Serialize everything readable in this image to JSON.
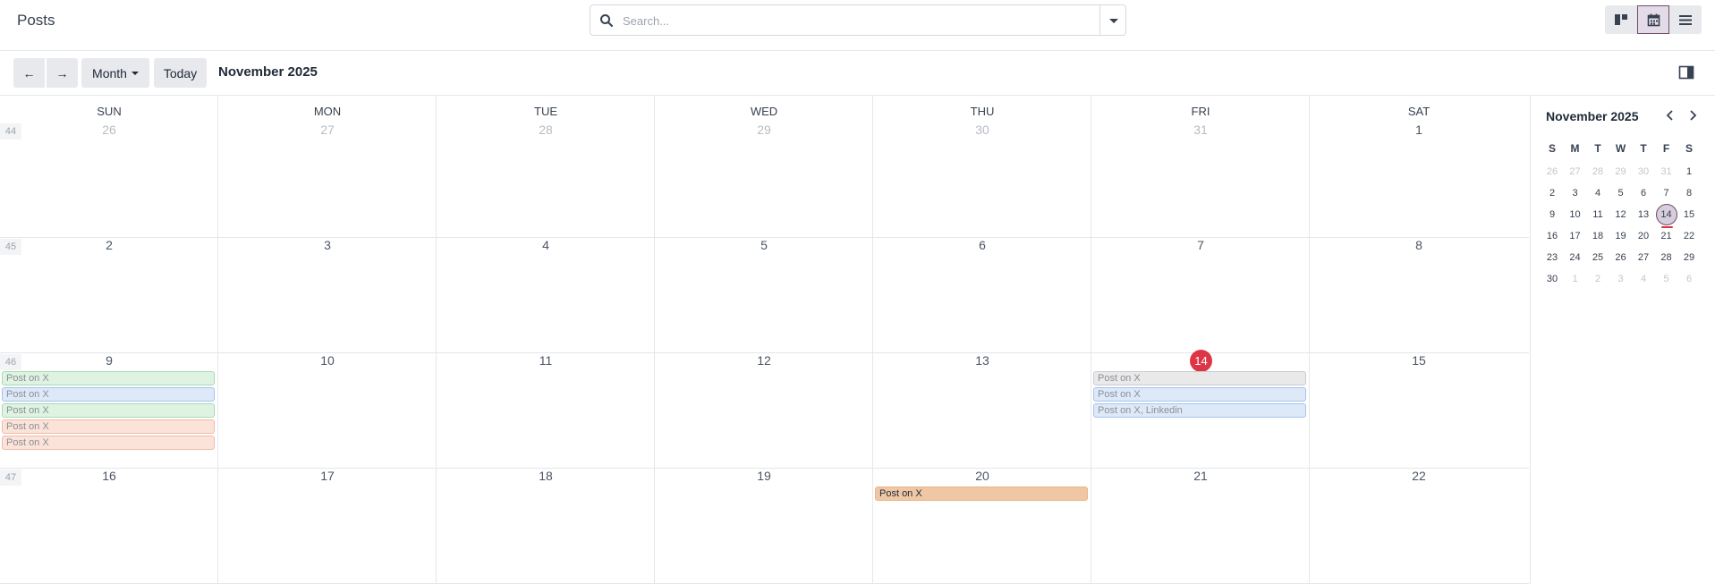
{
  "app": {
    "title": "Posts"
  },
  "search": {
    "placeholder": "Search..."
  },
  "views": [
    "kanban-view",
    "calendar-view",
    "list-view"
  ],
  "controls": {
    "prev_label": "←",
    "next_label": "→",
    "scale_label": "Month",
    "today_label": "Today",
    "period_title": "November 2025"
  },
  "calendar": {
    "day_headers": [
      "SUN",
      "MON",
      "TUE",
      "WED",
      "THU",
      "FRI",
      "SAT"
    ],
    "weeks": [
      {
        "number": "44",
        "days": [
          "26",
          "27",
          "28",
          "29",
          "30",
          "31",
          "1"
        ],
        "muted": [
          true,
          true,
          true,
          true,
          true,
          true,
          false
        ]
      },
      {
        "number": "45",
        "days": [
          "2",
          "3",
          "4",
          "5",
          "6",
          "7",
          "8"
        ],
        "muted": [
          false,
          false,
          false,
          false,
          false,
          false,
          false
        ]
      },
      {
        "number": "46",
        "days": [
          "9",
          "10",
          "11",
          "12",
          "13",
          "14",
          "15"
        ],
        "muted": [
          false,
          false,
          false,
          false,
          false,
          false,
          false
        ]
      },
      {
        "number": "47",
        "days": [
          "16",
          "17",
          "18",
          "19",
          "20",
          "21",
          "22"
        ],
        "muted": [
          false,
          false,
          false,
          false,
          false,
          false,
          false
        ]
      }
    ],
    "today": "14",
    "events": [
      {
        "label": "Post on X",
        "week": 2,
        "day": 0,
        "slot": 0,
        "color": "green"
      },
      {
        "label": "Post on X",
        "week": 2,
        "day": 0,
        "slot": 1,
        "color": "blue"
      },
      {
        "label": "Post on X",
        "week": 2,
        "day": 0,
        "slot": 2,
        "color": "green"
      },
      {
        "label": "Post on X",
        "week": 2,
        "day": 0,
        "slot": 3,
        "color": "salmon"
      },
      {
        "label": "Post on X",
        "week": 2,
        "day": 0,
        "slot": 4,
        "color": "salmon"
      },
      {
        "label": "Post on X",
        "week": 2,
        "day": 5,
        "slot": 0,
        "color": "gray"
      },
      {
        "label": "Post on X",
        "week": 2,
        "day": 5,
        "slot": 1,
        "color": "blue"
      },
      {
        "label": "Post on X, Linkedin",
        "week": 2,
        "day": 5,
        "slot": 2,
        "color": "blue"
      },
      {
        "label": "Post on X",
        "week": 3,
        "day": 4,
        "slot": 0,
        "color": "orange"
      }
    ]
  },
  "mini_calendar": {
    "title": "November 2025",
    "day_headers": [
      "S",
      "M",
      "T",
      "W",
      "T",
      "F",
      "S"
    ],
    "weeks": [
      [
        "26",
        "27",
        "28",
        "29",
        "30",
        "31",
        "1"
      ],
      [
        "2",
        "3",
        "4",
        "5",
        "6",
        "7",
        "8"
      ],
      [
        "9",
        "10",
        "11",
        "12",
        "13",
        "14",
        "15"
      ],
      [
        "16",
        "17",
        "18",
        "19",
        "20",
        "21",
        "22"
      ],
      [
        "23",
        "24",
        "25",
        "26",
        "27",
        "28",
        "29"
      ],
      [
        "30",
        "1",
        "2",
        "3",
        "4",
        "5",
        "6"
      ]
    ],
    "muted_first_row": 6,
    "muted_last_row_from": 1,
    "selected": "14"
  }
}
